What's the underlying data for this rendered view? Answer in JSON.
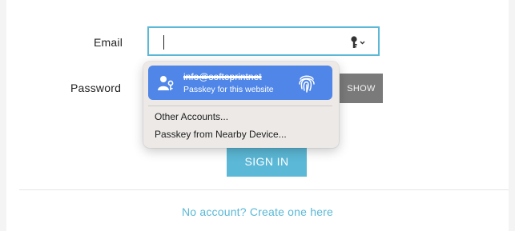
{
  "form": {
    "email_label": "Email",
    "email_value": "",
    "password_label": "Password",
    "show_label": "SHOW",
    "signin_label": "SIGN IN",
    "create_account_link": "No account? Create one here"
  },
  "autofill_popover": {
    "passkey_account": "info@softeprintnet",
    "passkey_subtitle": "Passkey for this website",
    "menu_items": [
      "Other Accounts...",
      "Passkey from Nearby Device..."
    ],
    "icons": [
      "person-key-icon",
      "fingerprint-icon",
      "key-icon"
    ]
  },
  "colors": {
    "accent": "#5bb8d6",
    "selection": "#4f86e8",
    "show_button": "#7a7a7a"
  }
}
